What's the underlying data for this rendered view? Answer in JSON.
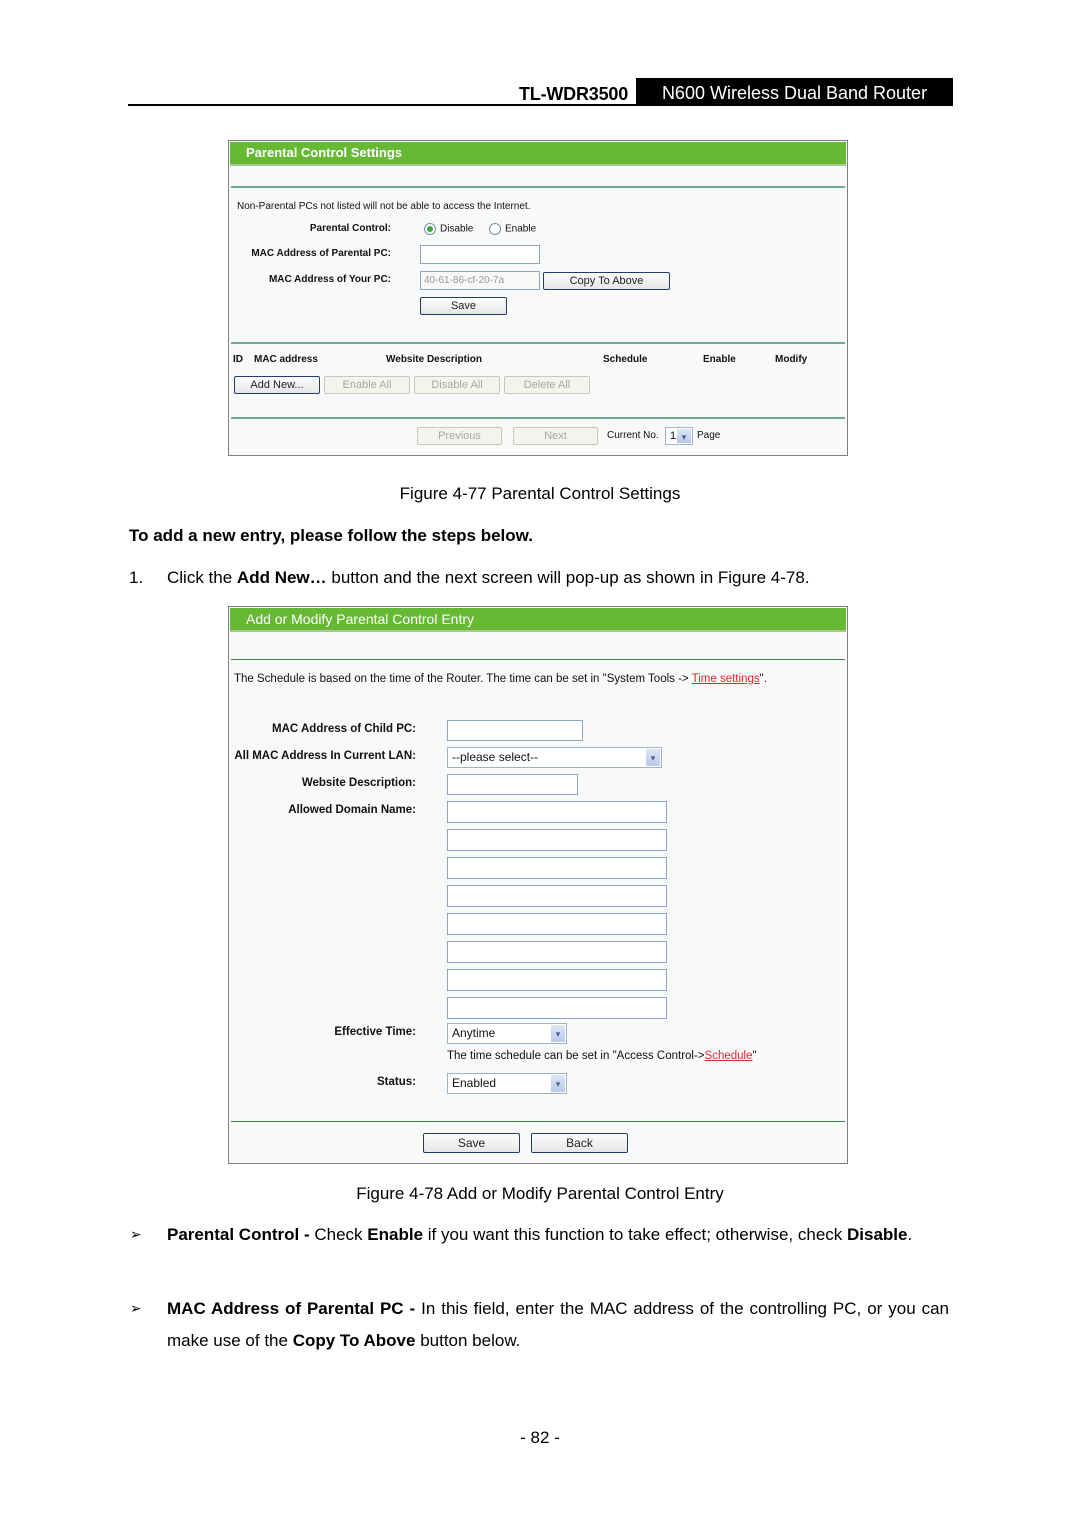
{
  "header": {
    "model": "TL-WDR3500",
    "product": "N600 Wireless Dual Band Router"
  },
  "figure77": {
    "title": "Parental Control Settings",
    "notice": "Non-Parental PCs not listed will not be able to access the Internet.",
    "parental_control_label": "Parental Control:",
    "radio_disable": "Disable",
    "radio_enable": "Enable",
    "selected": "Disable",
    "mac_parental_label": "MAC Address of Parental PC:",
    "mac_parental_value": "",
    "mac_your_label": "MAC Address of Your PC:",
    "mac_your_value": "40-61-86-cf-20-7a",
    "copy_button": "Copy To Above",
    "save_button": "Save",
    "table_headers": [
      "ID",
      "MAC address",
      "Website Description",
      "Schedule",
      "Enable",
      "Modify"
    ],
    "add_new_button": "Add New...",
    "enable_all_button": "Enable All",
    "disable_all_button": "Disable All",
    "delete_all_button": "Delete All",
    "previous_button": "Previous",
    "next_button": "Next",
    "current_no_label": "Current No.",
    "current_page": "1",
    "page_label": "Page",
    "caption": "Figure 4-77 Parental Control Settings"
  },
  "steps_heading": "To add a new entry, please follow the steps below.",
  "step1": {
    "number": "1.",
    "pre": "Click the ",
    "bold": "Add New…",
    "post": " button and the next screen will pop-up as shown in Figure 4-78."
  },
  "figure78": {
    "title": "Add or Modify Parental Control Entry",
    "notice_pre": "The Schedule is based on the time of the Router. The time can be set in \"System Tools -> ",
    "notice_link": "Time settings",
    "notice_post": "\".",
    "child_mac_label": "MAC Address of Child PC:",
    "child_mac_value": "",
    "all_mac_label": "All MAC Address In Current LAN:",
    "all_mac_selected": "--please select--",
    "website_desc_label": "Website Description:",
    "website_desc_value": "",
    "allowed_domain_label": "Allowed Domain Name:",
    "allowed_domains": [
      "",
      "",
      "",
      "",
      "",
      "",
      "",
      ""
    ],
    "effective_time_label": "Effective Time:",
    "effective_time_selected": "Anytime",
    "schedule_hint_pre": "The time schedule can be set in \"Access Control->",
    "schedule_hint_link": "Schedule",
    "schedule_hint_post": "\"",
    "status_label": "Status:",
    "status_selected": "Enabled",
    "save_button": "Save",
    "back_button": "Back",
    "caption": "Figure 4-78 Add or Modify Parental Control Entry"
  },
  "bullets": [
    {
      "symbol": "➢",
      "term": "Parental Control - ",
      "text1": "Check ",
      "bold1": "Enable",
      "text2": " if you want this function to take effect; otherwise, check ",
      "bold2": "Disable",
      "text3": "."
    },
    {
      "symbol": "➢",
      "term": "MAC Address of Parental PC - ",
      "text1": "In this field, enter the MAC address of the controlling PC, or you can make use of the ",
      "bold1": "Copy To Above",
      "text2": " button below."
    }
  ],
  "page_number": "- 82 -"
}
